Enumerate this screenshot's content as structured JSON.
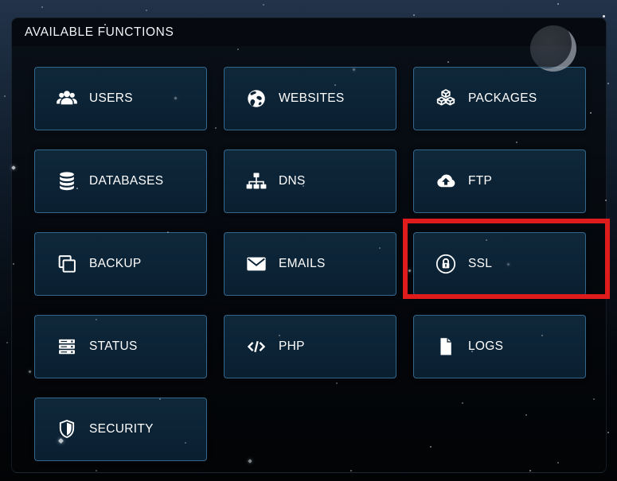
{
  "header": {
    "title": "AVAILABLE FUNCTIONS"
  },
  "functions": [
    {
      "label": "USERS",
      "icon": "users-icon",
      "highlighted": false
    },
    {
      "label": "WEBSITES",
      "icon": "globe-icon",
      "highlighted": false
    },
    {
      "label": "PACKAGES",
      "icon": "cubes-icon",
      "highlighted": false
    },
    {
      "label": "DATABASES",
      "icon": "database-icon",
      "highlighted": false
    },
    {
      "label": "DNS",
      "icon": "sitemap-icon",
      "highlighted": false
    },
    {
      "label": "FTP",
      "icon": "cloud-upload-icon",
      "highlighted": false
    },
    {
      "label": "BACKUP",
      "icon": "clone-icon",
      "highlighted": false
    },
    {
      "label": "EMAILS",
      "icon": "envelope-icon",
      "highlighted": false
    },
    {
      "label": "SSL",
      "icon": "lock-circle-icon",
      "highlighted": true
    },
    {
      "label": "STATUS",
      "icon": "server-icon",
      "highlighted": false
    },
    {
      "label": "PHP",
      "icon": "code-icon",
      "highlighted": false
    },
    {
      "label": "LOGS",
      "icon": "file-icon",
      "highlighted": false
    },
    {
      "label": "SECURITY",
      "icon": "shield-icon",
      "highlighted": false
    }
  ],
  "highlight_box": {
    "target": "SSL",
    "color": "#df1b1b"
  },
  "colors": {
    "button_background": "#0c2336",
    "button_border": "#33678c",
    "header_background": "#06090f",
    "text": "#ffffff",
    "background_top": "#22334a",
    "background_bottom": "#020304"
  }
}
